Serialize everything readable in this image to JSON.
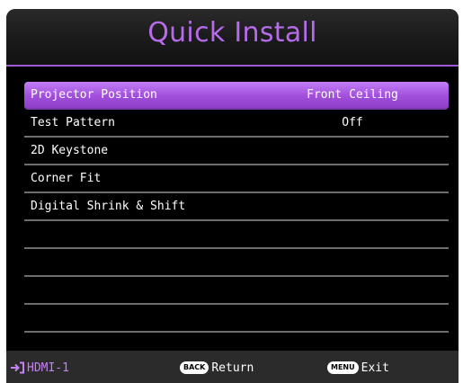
{
  "header": {
    "title": "Quick Install"
  },
  "menu": {
    "items": [
      {
        "label": "Projector Position",
        "value": "Front Ceiling",
        "selected": true
      },
      {
        "label": "Test Pattern",
        "value": "Off",
        "selected": false
      },
      {
        "label": "2D Keystone",
        "value": "",
        "selected": false
      },
      {
        "label": "Corner Fit",
        "value": "",
        "selected": false
      },
      {
        "label": "Digital Shrink & Shift",
        "value": "",
        "selected": false
      },
      {
        "label": "",
        "value": "",
        "selected": false
      },
      {
        "label": "",
        "value": "",
        "selected": false
      },
      {
        "label": "",
        "value": "",
        "selected": false
      },
      {
        "label": "",
        "value": "",
        "selected": false
      },
      {
        "label": "",
        "value": "",
        "selected": false
      }
    ]
  },
  "footer": {
    "source": {
      "icon": "input-source-icon",
      "label": "HDMI-1"
    },
    "back": {
      "button": "BACK",
      "label": "Return"
    },
    "menu": {
      "button": "MENU",
      "label": "Exit"
    }
  },
  "colors": {
    "accent": "#b66cea",
    "highlight": "#a14fdb",
    "background": "#000000",
    "footer": "#2b2b2b"
  }
}
